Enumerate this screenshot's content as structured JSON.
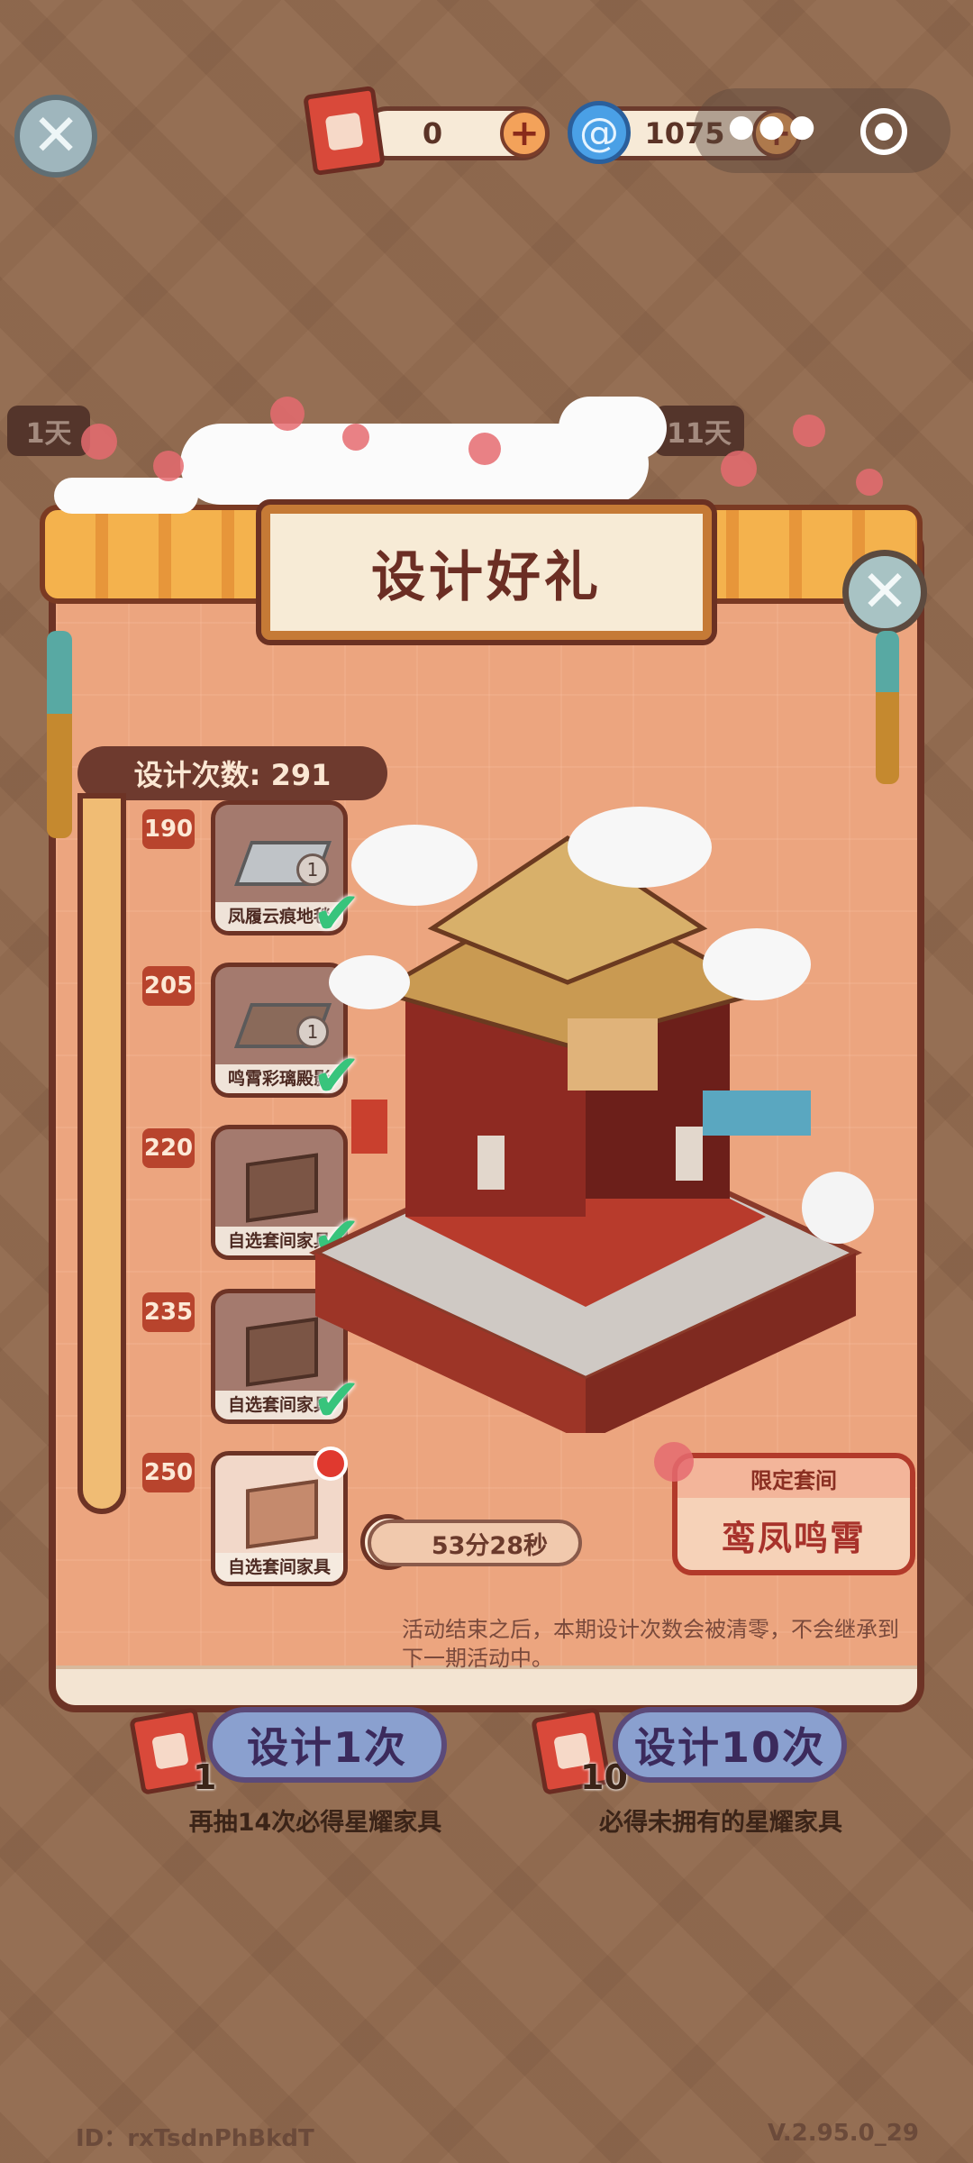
{
  "topbar": {
    "scroll_count": "0",
    "gem_count": "1075",
    "more_icon": "more-dots-icon",
    "target_icon": "target-icon"
  },
  "background": {
    "day_tabs": [
      "1天",
      "11天"
    ]
  },
  "modal": {
    "title": "设计好礼",
    "design_count_label": "设计次数: 291",
    "milestones": [
      {
        "num": "190",
        "label": "凤履云痕地毯",
        "qty": "1",
        "claimed": true
      },
      {
        "num": "205",
        "label": "鸣霄彩璃殿影",
        "qty": "1",
        "claimed": true
      },
      {
        "num": "220",
        "label": "自选套间家具",
        "qty": "",
        "claimed": true
      },
      {
        "num": "235",
        "label": "自选套间家具",
        "qty": "",
        "claimed": true
      },
      {
        "num": "250",
        "label": "自选套间家具",
        "qty": "",
        "claimed": false
      }
    ],
    "timer": "53分28秒",
    "set_badge_top": "限定套间",
    "set_badge_name": "鸾凤鸣霄",
    "notice": "活动结束之后，本期设计次数会被清零，不会继承到下一期活动中。"
  },
  "actions": {
    "single_label": "设计1次",
    "single_cost": "1",
    "single_hint": "再抽14次必得星耀家具",
    "ten_label": "设计10次",
    "ten_cost": "10",
    "ten_hint": "必得未拥有的星耀家具"
  },
  "footer": {
    "user_id": "ID：rxTsdnPhBkdT",
    "version": "V.2.95.0_29"
  },
  "colors": {
    "modal_bg": "#eca57f",
    "border": "#6d3325",
    "accent_red": "#b23a2a",
    "check_green": "#38c47c",
    "button_blue": "#8aa0cf"
  }
}
